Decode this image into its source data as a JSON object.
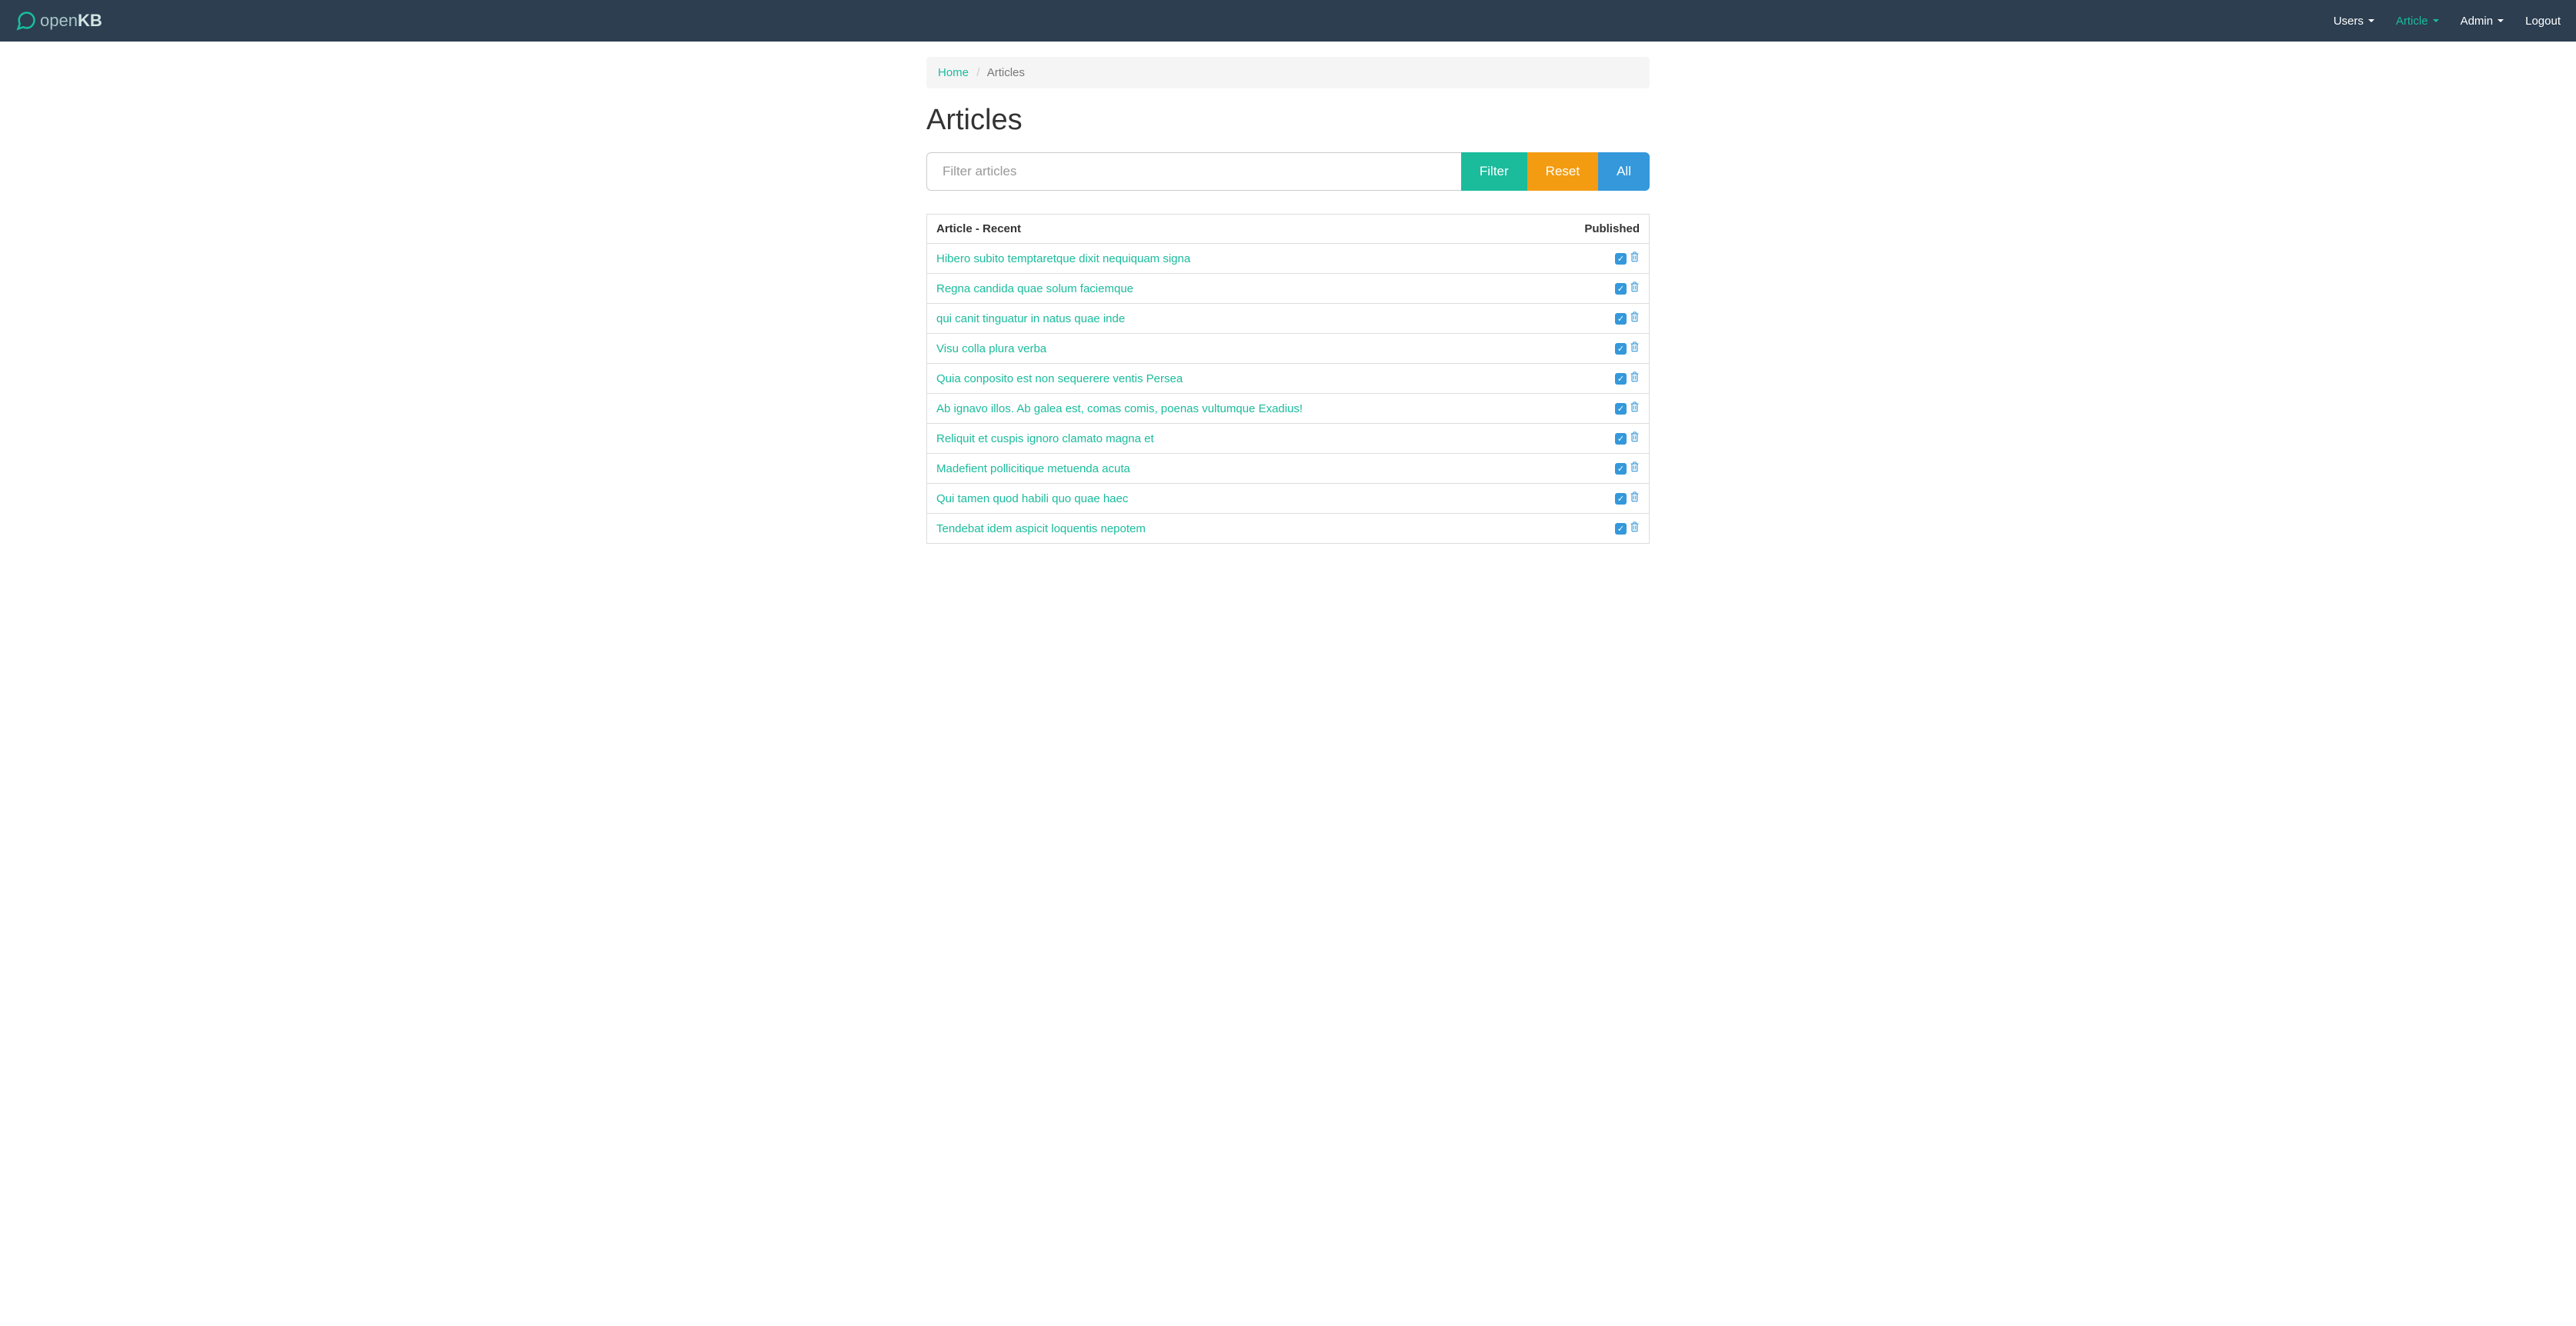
{
  "brand": {
    "open": "open",
    "kb": "KB"
  },
  "nav": {
    "users": "Users",
    "article": "Article",
    "admin": "Admin",
    "logout": "Logout"
  },
  "breadcrumb": {
    "home": "Home",
    "current": "Articles"
  },
  "page_title": "Articles",
  "filter": {
    "placeholder": "Filter articles",
    "filter_btn": "Filter",
    "reset_btn": "Reset",
    "all_btn": "All"
  },
  "table": {
    "col_article": "Article - Recent",
    "col_published": "Published"
  },
  "articles": [
    {
      "title": "Hibero subito temptaretque dixit nequiquam signa",
      "published": true
    },
    {
      "title": "Regna candida quae solum faciemque",
      "published": true
    },
    {
      "title": "qui canit tinguatur in natus quae inde",
      "published": true
    },
    {
      "title": "Visu colla plura verba",
      "published": true
    },
    {
      "title": "Quia conposito est non sequerere ventis Persea",
      "published": true
    },
    {
      "title": "Ab ignavo illos. Ab galea est, comas comis, poenas vultumque Exadius!",
      "published": true
    },
    {
      "title": "Reliquit et cuspis ignoro clamato magna et",
      "published": true
    },
    {
      "title": "Madefient pollicitique metuenda acuta",
      "published": true
    },
    {
      "title": "Qui tamen quod habili quo quae haec",
      "published": true
    },
    {
      "title": "Tendebat idem aspicit loquentis nepotem",
      "published": true
    }
  ]
}
